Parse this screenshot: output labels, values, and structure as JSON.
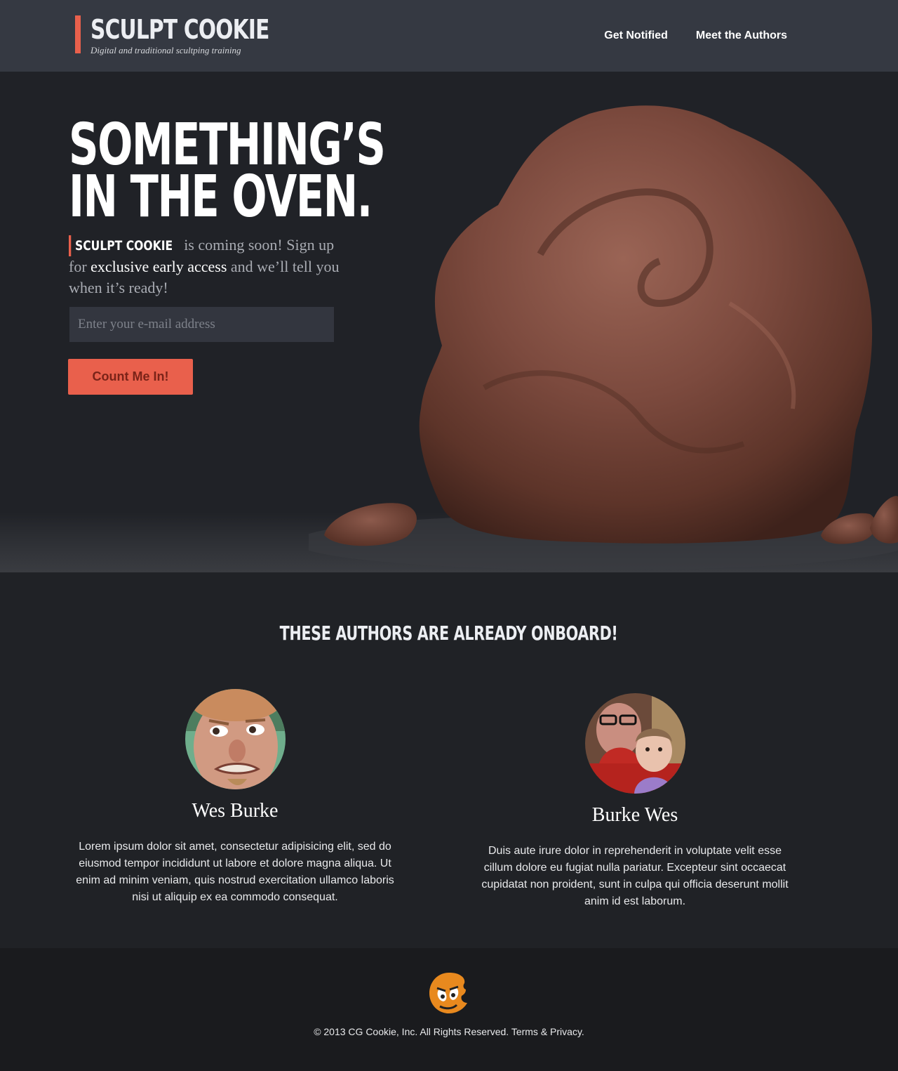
{
  "header": {
    "logo_title": "SCULPT COOKIE",
    "logo_tagline": "Digital and traditional scultping training",
    "nav": [
      {
        "label": "Get Notified"
      },
      {
        "label": "Meet the Authors"
      }
    ]
  },
  "hero": {
    "headline_line1": "SOMETHING’S",
    "headline_line2": "IN THE OVEN.",
    "intro_brand": "SCULPT COOKIE",
    "intro_text_1": " is coming soon! Sign up for ",
    "intro_emphasis": "exclusive early access",
    "intro_text_2": " and we’ll tell you when it’s ready!",
    "email_placeholder": "Enter your e-mail address",
    "cta_label": "Count Me In!"
  },
  "authors": {
    "title": "THESE AUTHORS ARE ALREADY ONBOARD!",
    "items": [
      {
        "name": "Wes Burke",
        "bio": "Lorem ipsum dolor sit amet, consectetur adipisicing elit, sed do eiusmod tempor incididunt ut labore et dolore magna aliqua. Ut enim ad minim veniam, quis nostrud exercitation ullamco laboris nisi ut aliquip ex ea commodo consequat."
      },
      {
        "name": "Burke Wes",
        "bio": "Duis aute irure dolor in reprehenderit in voluptate velit esse cillum dolore eu fugiat nulla pariatur. Excepteur sint occaecat cupidatat non proident, sunt in culpa qui officia deserunt mollit anim id est laborum."
      }
    ]
  },
  "footer": {
    "logo_icon": "cg-cookie-logo-icon",
    "copyright": "© 2013 CG Cookie, Inc. All Rights Reserved. Terms & Privacy."
  },
  "colors": {
    "accent": "#e9604c",
    "header_bg": "#353942",
    "page_bg": "#202226",
    "footer_bg": "#1a1b1e",
    "logo_orange": "#e8891e"
  }
}
